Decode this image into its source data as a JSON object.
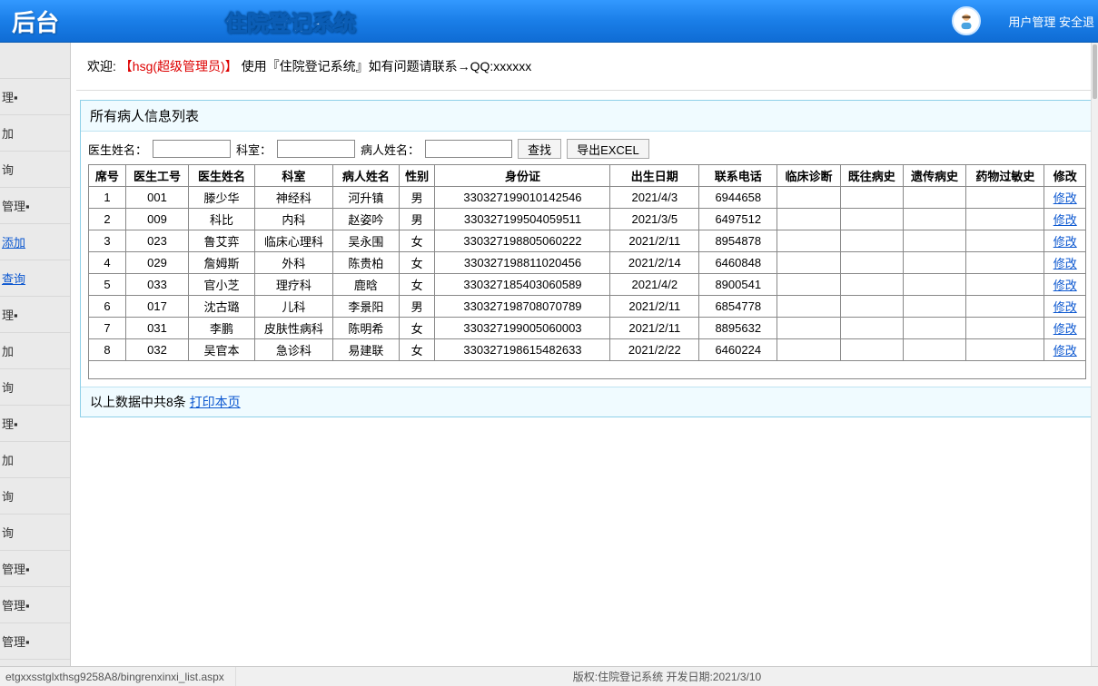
{
  "header": {
    "backend": "后台",
    "title": "住院登记系统",
    "right_link1": "用户管理",
    "right_link2": "安全退"
  },
  "sidebar": {
    "items": [
      {
        "label": "",
        "kind": "plain"
      },
      {
        "label": "理▪",
        "kind": "plain"
      },
      {
        "label": "加",
        "kind": "plain"
      },
      {
        "label": "询",
        "kind": "plain"
      },
      {
        "label": "管理▪",
        "kind": "plain"
      },
      {
        "label": "添加",
        "kind": "link"
      },
      {
        "label": "查询",
        "kind": "link"
      },
      {
        "label": "理▪",
        "kind": "plain"
      },
      {
        "label": "加",
        "kind": "plain"
      },
      {
        "label": "询",
        "kind": "plain"
      },
      {
        "label": "理▪",
        "kind": "plain"
      },
      {
        "label": "加",
        "kind": "plain"
      },
      {
        "label": "询",
        "kind": "plain"
      },
      {
        "label": "询",
        "kind": "plain"
      },
      {
        "label": "管理▪",
        "kind": "plain"
      },
      {
        "label": "管理▪",
        "kind": "plain"
      },
      {
        "label": "管理▪",
        "kind": "plain"
      }
    ]
  },
  "welcome": {
    "prefix": "欢迎:",
    "user": "【hsg(超级管理员)】",
    "mid": "使用『住院登记系统』如有问题请联系→QQ:xxxxxx"
  },
  "panel": {
    "title": "所有病人信息列表",
    "filters": {
      "doctor_name_label": "医生姓名：",
      "dept_label": "科室：",
      "patient_name_label": "病人姓名：",
      "search_btn": "查找",
      "export_btn": "导出EXCEL"
    },
    "columns": [
      "席号",
      "医生工号",
      "医生姓名",
      "科室",
      "病人姓名",
      "性别",
      "身份证",
      "出生日期",
      "联系电话",
      "临床诊断",
      "既往病史",
      "遗传病史",
      "药物过敏史",
      "修改"
    ],
    "modify_label": "修改",
    "rows": [
      {
        "seq": "1",
        "doc_id": "001",
        "doc_name": "滕少华",
        "dept": "神经科",
        "pat": "河升镇",
        "sex": "男",
        "idc": "330327199010142546",
        "dob": "2021/4/3",
        "tel": "6944658"
      },
      {
        "seq": "2",
        "doc_id": "009",
        "doc_name": "科比",
        "dept": "内科",
        "pat": "赵姿吟",
        "sex": "男",
        "idc": "330327199504059511",
        "dob": "2021/3/5",
        "tel": "6497512"
      },
      {
        "seq": "3",
        "doc_id": "023",
        "doc_name": "鲁艾弈",
        "dept": "临床心理科",
        "pat": "吴永围",
        "sex": "女",
        "idc": "330327198805060222",
        "dob": "2021/2/11",
        "tel": "8954878"
      },
      {
        "seq": "4",
        "doc_id": "029",
        "doc_name": "詹姆斯",
        "dept": "外科",
        "pat": "陈贵柏",
        "sex": "女",
        "idc": "330327198811020456",
        "dob": "2021/2/14",
        "tel": "6460848"
      },
      {
        "seq": "5",
        "doc_id": "033",
        "doc_name": "官小芝",
        "dept": "理疗科",
        "pat": "鹿晗",
        "sex": "女",
        "idc": "330327185403060589",
        "dob": "2021/4/2",
        "tel": "8900541"
      },
      {
        "seq": "6",
        "doc_id": "017",
        "doc_name": "沈古璐",
        "dept": "儿科",
        "pat": "李景阳",
        "sex": "男",
        "idc": "330327198708070789",
        "dob": "2021/2/11",
        "tel": "6854778"
      },
      {
        "seq": "7",
        "doc_id": "031",
        "doc_name": "李鹏",
        "dept": "皮肤性病科",
        "pat": "陈明希",
        "sex": "女",
        "idc": "330327199005060003",
        "dob": "2021/2/11",
        "tel": "8895632"
      },
      {
        "seq": "8",
        "doc_id": "032",
        "doc_name": "吴官本",
        "dept": "急诊科",
        "pat": "易建联",
        "sex": "女",
        "idc": "330327198615482633",
        "dob": "2021/2/22",
        "tel": "6460224"
      }
    ],
    "footer_text": "以上数据中共8条",
    "print_link": "打印本页"
  },
  "status": {
    "url": "etgxxsstglxthsg9258A8/bingrenxinxi_list.aspx",
    "copyright": "版权:住院登记系统 开发日期:2021/3/10"
  }
}
